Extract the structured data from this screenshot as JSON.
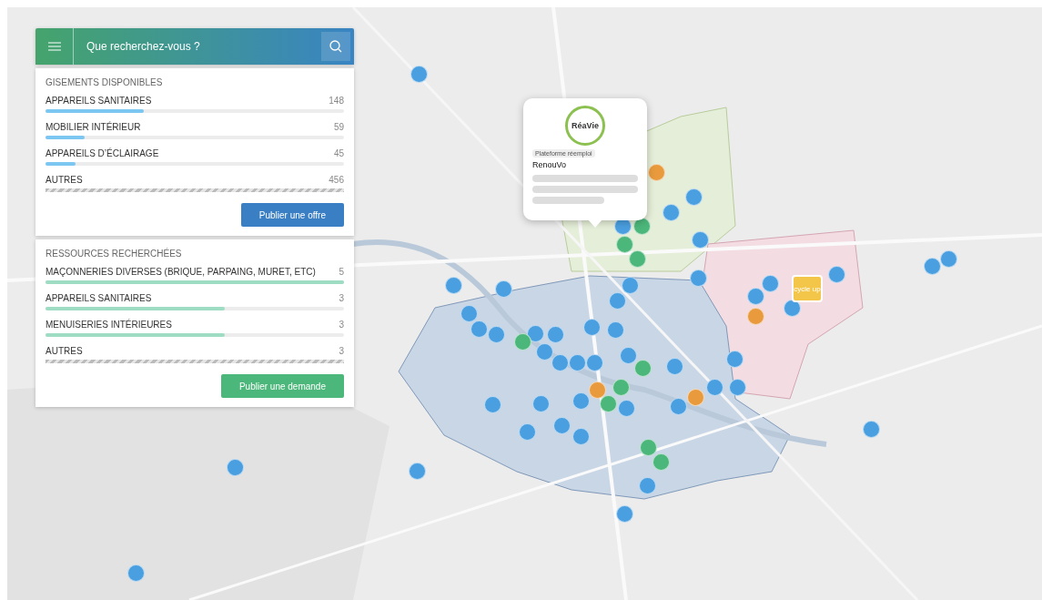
{
  "search": {
    "placeholder": "Que recherchez-vous ?"
  },
  "offers": {
    "title": "GISEMENTS DISPONIBLES",
    "button": "Publier une offre",
    "items": [
      {
        "kind": "bar",
        "label": "APPAREILS SANITAIRES",
        "count": "148",
        "level": 0.33
      },
      {
        "kind": "bar",
        "label": "MOBILIER INTÉRIEUR",
        "count": "59",
        "level": 0.13
      },
      {
        "kind": "bar",
        "label": "APPAREILS D’ÉCLAIRAGE",
        "count": "45",
        "level": 0.1
      },
      {
        "kind": "striped",
        "label": "AUTRES",
        "count": "456"
      }
    ]
  },
  "requests": {
    "title": "RESSOURCES RECHERCHÉES",
    "button": "Publier une demande",
    "items": [
      {
        "kind": "bar",
        "label": "MAÇONNERIES DIVERSES (BRIQUE, PARPAING, MURET, ETC)",
        "count": "5",
        "level": 1
      },
      {
        "kind": "bar",
        "label": "APPAREILS SANITAIRES",
        "count": "3",
        "level": 0.6
      },
      {
        "kind": "bar",
        "label": "MENUISERIES INTÉRIEURES",
        "count": "3",
        "level": 0.6
      },
      {
        "kind": "striped",
        "label": "AUTRES",
        "count": "3"
      }
    ]
  },
  "popup": {
    "logo": "RéaVie",
    "tag": "Plateforme réemploi",
    "name": "RenouVo"
  },
  "badge": {
    "label": "cycle up"
  },
  "markers": [
    {
      "color": "#4a9fe0"
    },
    {
      "color": "#4a9fe0"
    },
    {
      "color": "#4a9fe0"
    },
    {
      "color": "#4a9fe0"
    },
    {
      "color": "#4a9fe0"
    },
    {
      "color": "#4a9fe0"
    },
    {
      "color": "#4a9fe0"
    },
    {
      "color": "#4a9fe0"
    },
    {
      "color": "#4a9fe0"
    },
    {
      "color": "#4a9fe0"
    },
    {
      "color": "#4a9fe0"
    },
    {
      "color": "#4a9fe0"
    },
    {
      "color": "#4a9fe0"
    },
    {
      "color": "#4a9fe0"
    },
    {
      "color": "#4a9fe0"
    },
    {
      "color": "#4a9fe0"
    },
    {
      "color": "#4a9fe0"
    },
    {
      "color": "#4a9fe0"
    },
    {
      "color": "#4a9fe0"
    },
    {
      "color": "#4a9fe0"
    },
    {
      "color": "#4a9fe0"
    },
    {
      "color": "#4a9fe0"
    },
    {
      "color": "#4a9fe0"
    },
    {
      "color": "#4a9fe0"
    },
    {
      "color": "#4a9fe0"
    },
    {
      "color": "#4a9fe0"
    },
    {
      "color": "#4a9fe0"
    },
    {
      "color": "#4a9fe0"
    },
    {
      "color": "#4a9fe0"
    },
    {
      "color": "#4a9fe0"
    },
    {
      "color": "#4a9fe0"
    },
    {
      "color": "#4a9fe0"
    },
    {
      "color": "#4a9fe0"
    },
    {
      "color": "#4a9fe0"
    },
    {
      "color": "#4a9fe0"
    },
    {
      "color": "#4a9fe0"
    },
    {
      "color": "#4a9fe0"
    },
    {
      "color": "#4a9fe0"
    },
    {
      "color": "#4a9fe0"
    },
    {
      "color": "#4a9fe0"
    },
    {
      "color": "#4a9fe0"
    },
    {
      "color": "#4a9fe0"
    },
    {
      "color": "#4a9fe0"
    },
    {
      "color": "#4a9fe0"
    },
    {
      "color": "#4a9fe0"
    },
    {
      "color": "#4a9fe0"
    },
    {
      "color": "#4cb77a"
    },
    {
      "color": "#4cb77a"
    },
    {
      "color": "#4cb77a"
    },
    {
      "color": "#4cb77a"
    },
    {
      "color": "#4cb77a"
    },
    {
      "color": "#4cb77a"
    },
    {
      "color": "#4cb77a"
    },
    {
      "color": "#4cb77a"
    },
    {
      "color": "#4cb77a"
    },
    {
      "color": "#e89a3c"
    },
    {
      "color": "#e89a3c"
    },
    {
      "color": "#e89a3c"
    },
    {
      "color": "#e89a3c"
    }
  ]
}
